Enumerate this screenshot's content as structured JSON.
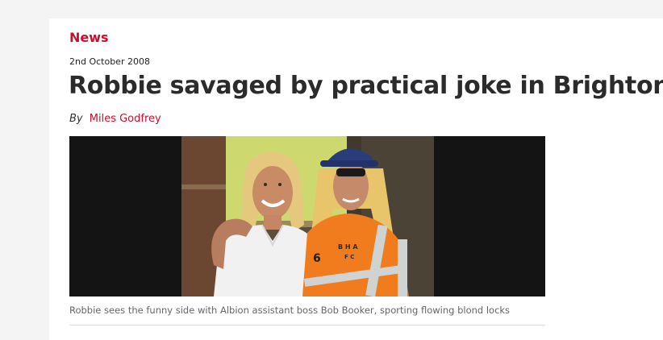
{
  "article": {
    "section": "News",
    "date": "2nd October 2008",
    "headline": "Robbie savaged by practical joke in Brighton",
    "byline_prefix": "By",
    "author": "Miles Godfrey",
    "caption": "Robbie sees the funny side with Albion assistant boss Bob Booker, sporting flowing blond locks",
    "photo_text": {
      "badge_line1": "B  H  A",
      "badge_line2": "F C",
      "number": "6"
    }
  },
  "colors": {
    "accent": "#c8102e",
    "headline": "#2b2b2b",
    "caption": "#666666",
    "page_bg": "#f4f4f4",
    "jacket": "#f07c1e",
    "reflective": "#cfd3d2"
  }
}
